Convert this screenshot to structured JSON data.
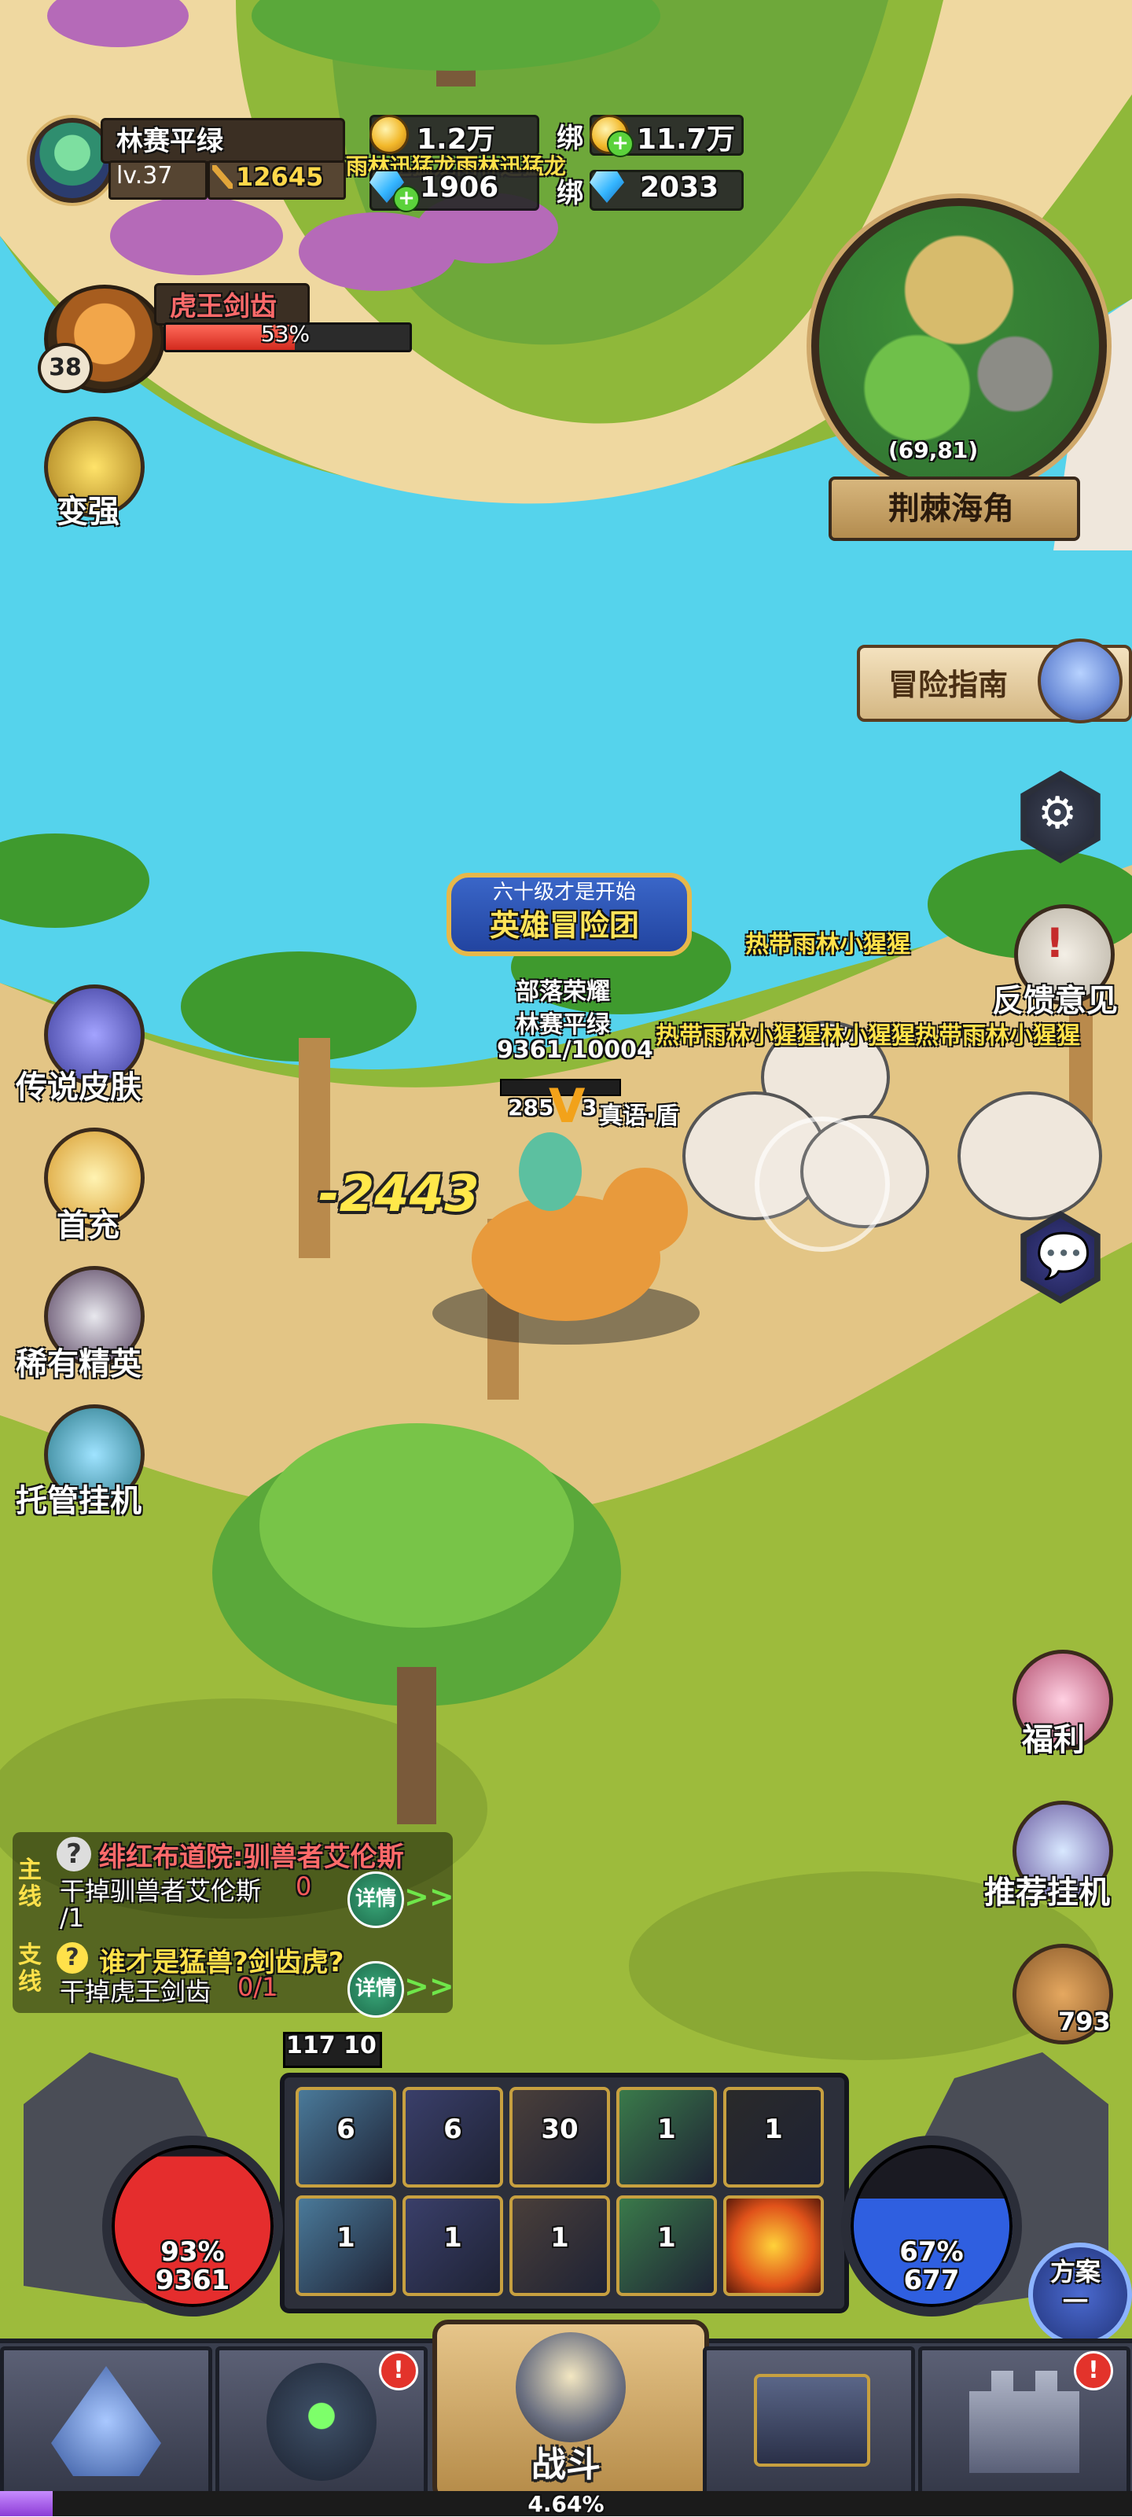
{
  "player": {
    "name": "林赛平绿",
    "level": "lv.37",
    "power": "12645"
  },
  "currency": {
    "gold": "1.2万",
    "diamonds": "1906",
    "bound_label_1": "绑",
    "bound_gold": "11.7万",
    "bound_label_2": "绑",
    "bound_diamonds": "2033"
  },
  "top_banner_overlap": "雨林迅猛龙雨林迅猛龙",
  "boss": {
    "name": "虎王剑齿",
    "hp_text": "53%",
    "hp_fraction": 0.53,
    "level": "38"
  },
  "minimap": {
    "coords": "(69,81)",
    "area_name": "荆棘海角"
  },
  "guide": {
    "label": "冒险指南"
  },
  "left_menu": [
    {
      "label": "变强"
    },
    {
      "label": "传说皮肤"
    },
    {
      "label": "首充"
    },
    {
      "label": "稀有精英"
    },
    {
      "label": "托管挂机"
    }
  ],
  "right_menu": {
    "feedback": "反馈意见",
    "welfare": "福利",
    "recommended_idle": "推荐挂机",
    "bread_count": "793"
  },
  "battle": {
    "title_small": "六十级才是开始",
    "title_main": "英雄冒险团",
    "guild": "部落荣耀",
    "player_name": "林赛平绿",
    "hp_text": "9361/10004",
    "shield_value": "285",
    "shield_suffix": "3",
    "skill_name": "真语·盾",
    "damage": "-2443",
    "enemy_name_1": "热带雨林小猩猩",
    "enemy_name_2": "热带雨林小猩猩林小猩猩热带雨林小猩猩"
  },
  "quests": {
    "main_tag": "主线",
    "main_title": "绯红布道院:驯兽者艾伦斯",
    "main_desc": "干掉驯兽者艾伦斯",
    "main_progress_cur": "0",
    "main_progress_total": "/1",
    "side_tag": "支线",
    "side_title": "谁才是猛兽?剑齿虎?",
    "side_desc": "干掉虎王剑齿",
    "side_progress": "0/1",
    "detail_label": "详情",
    "chevron": ">>"
  },
  "skills": {
    "top_indicator": "117 10",
    "row1": [
      "6",
      "6",
      "30",
      "1",
      "1"
    ],
    "row2": [
      "1",
      "1",
      "1",
      "1",
      ""
    ]
  },
  "hp_orb": {
    "percent": "93%",
    "value": "9361",
    "fraction": 0.93
  },
  "mp_orb": {
    "percent": "67%",
    "value": "677",
    "fraction": 0.67
  },
  "scheme_button": "方案\n一",
  "nav": {
    "fight_label": "战斗",
    "badge": "!"
  },
  "xp": {
    "percent": "4.64%",
    "fraction": 0.0464
  },
  "colors": {
    "hp_red": "#e52d2d",
    "mp_blue": "#2f5fe0",
    "accent_gold": "#ffd84a"
  }
}
